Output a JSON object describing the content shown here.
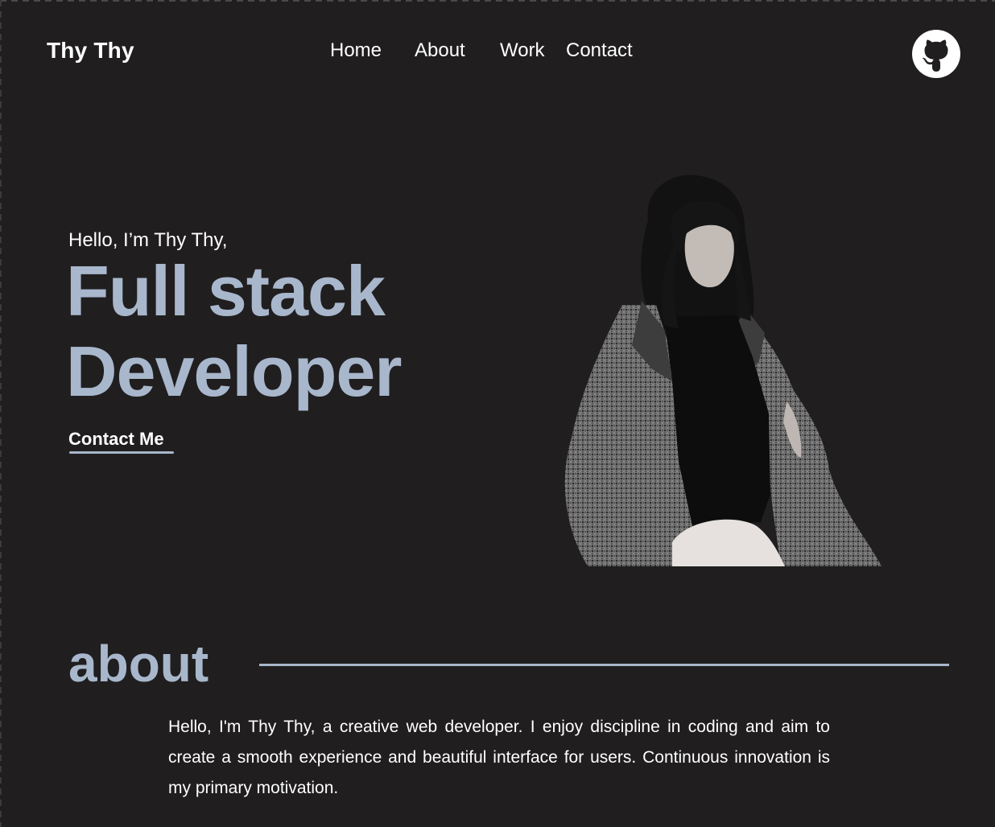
{
  "header": {
    "logo": "Thy Thy",
    "nav": {
      "home": "Home",
      "about": "About",
      "work": "Work",
      "contact": "Contact"
    },
    "github_icon": "github-icon"
  },
  "hero": {
    "greeting": "Hello, I’m Thy Thy,",
    "headline_line1": "Full stack",
    "headline_line2": "Developer",
    "cta": "Contact Me",
    "image": "portrait-photo"
  },
  "about": {
    "title": "about",
    "body": "Hello, I'm Thy Thy, a creative web developer. I enjoy discipline in coding and aim to create a smooth experience and beautiful interface for users. Continuous innovation is my primary motivation."
  },
  "colors": {
    "background": "#201e1f",
    "accent": "#a8b7cb",
    "text": "#ffffff"
  }
}
